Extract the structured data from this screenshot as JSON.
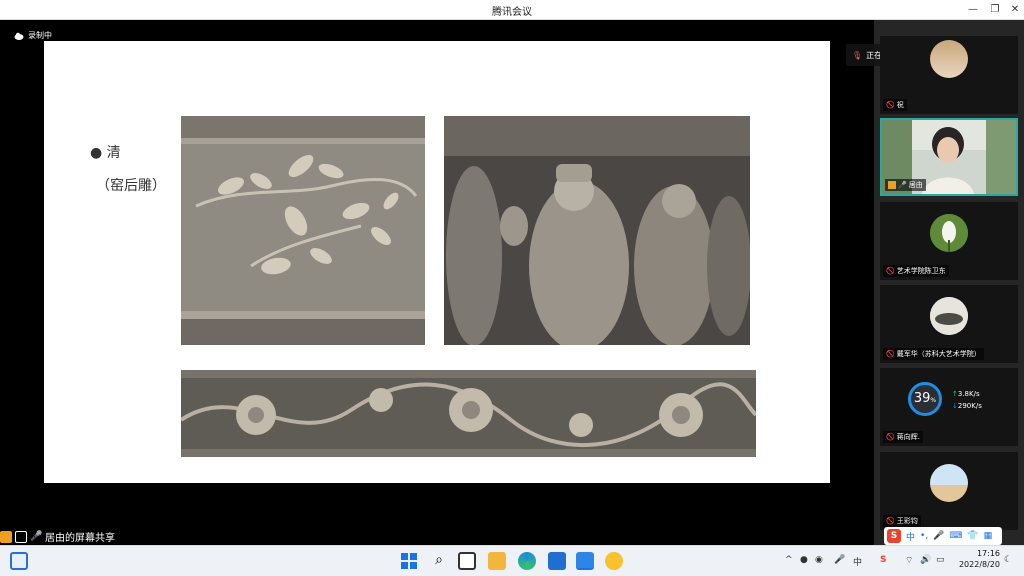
{
  "app": {
    "title": "腾讯会议"
  },
  "recording": {
    "label": "录制中"
  },
  "slide": {
    "bullet": "清",
    "subtitle": "（窑后雕）"
  },
  "share": {
    "label": "居由的屏幕共享"
  },
  "speaking": {
    "label": "正在讲话: 居由;"
  },
  "participants": [
    {
      "name": "祝",
      "muted": true
    },
    {
      "name": "居由",
      "muted": false,
      "speaking": true
    },
    {
      "name": "艺术学院陈卫东",
      "muted": true
    },
    {
      "name": "戴军华（苏科大艺术学院）",
      "muted": true
    },
    {
      "name": "蒋向辉.",
      "muted": true
    },
    {
      "name": "王彩钧",
      "muted": true
    }
  ],
  "network_widget": {
    "percent": "39",
    "unit": "%",
    "up": "3.8",
    "up_unit": "K/s",
    "down": "290",
    "down_unit": "K/s"
  },
  "ime": {
    "mode": "中"
  },
  "tray": {
    "lang": "中",
    "ime_s": "S"
  },
  "clock": {
    "time": "17:16",
    "date": "2022/8/20"
  },
  "colors": {
    "accent": "#2aa9a0",
    "titlebar": "#ffffff",
    "taskbar": "#eef1f5",
    "ime_red": "#e8432e"
  }
}
